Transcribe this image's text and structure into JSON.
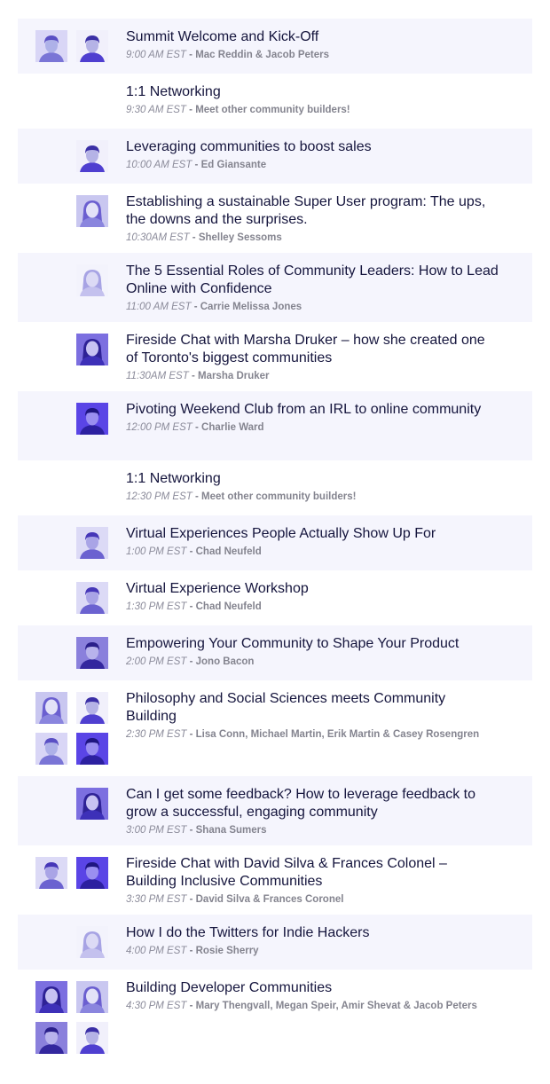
{
  "sessions": [
    {
      "title": "Summit Welcome and Kick-Off",
      "time": "9:00 AM EST",
      "speakers": "Mac Reddin & Jacob Peters",
      "avatars": [
        "a",
        "b"
      ]
    },
    {
      "title": "1:1 Networking",
      "time": "9:30 AM EST",
      "speakers": "Meet other community builders!",
      "avatars": []
    },
    {
      "title": "Leveraging communities to boost sales",
      "time": "10:00 AM EST",
      "speakers": "Ed Giansante",
      "avatars": [
        "b"
      ]
    },
    {
      "title": "Establishing a sustainable Super User program: The ups, the downs and the surprises.",
      "time": "10:30AM EST",
      "speakers": "Shelley Sessoms",
      "avatars": [
        "c"
      ]
    },
    {
      "title": "The 5 Essential Roles of Community Leaders: How to Lead Online with Confidence",
      "time": "11:00 AM EST",
      "speakers": "Carrie Melissa Jones",
      "avatars": [
        "d"
      ]
    },
    {
      "title": "Fireside Chat with Marsha Druker – how she created one of Toronto's biggest communities",
      "time": "11:30AM EST",
      "speakers": "Marsha Druker",
      "avatars": [
        "e"
      ]
    },
    {
      "title": "Pivoting Weekend Club from an IRL to online community",
      "time": "12:00 PM EST",
      "speakers": "Charlie Ward",
      "avatars": [
        "f"
      ]
    },
    {
      "title": "1:1 Networking",
      "time": "12:30 PM EST",
      "speakers": "Meet other community builders!",
      "avatars": []
    },
    {
      "title": "Virtual Experiences People Actually Show Up For",
      "time": "1:00 PM EST",
      "speakers": "Chad Neufeld",
      "avatars": [
        "g"
      ]
    },
    {
      "title": "Virtual Experience Workshop",
      "time": "1:30 PM EST",
      "speakers": "Chad Neufeld",
      "avatars": [
        "g"
      ]
    },
    {
      "title": "Empowering Your Community to Shape Your Product",
      "time": "2:00 PM EST",
      "speakers": "Jono Bacon",
      "avatars": [
        "h"
      ]
    },
    {
      "title": "Philosophy and Social Sciences meets Community Building",
      "time": "2:30 PM EST",
      "speakers": "Lisa Conn, Michael Martin, Erik Martin & Casey Rosengren",
      "avatars": [
        "c",
        "b",
        "a",
        "f"
      ]
    },
    {
      "title": "Can I get some feedback? How to leverage feedback to grow a successful, engaging community",
      "time": "3:00 PM EST",
      "speakers": "Shana Sumers",
      "avatars": [
        "e"
      ]
    },
    {
      "title": "Fireside Chat with David Silva & Frances Colonel – Building Inclusive Communities",
      "time": "3:30 PM  EST",
      "speakers": "David Silva & Frances Coronel",
      "avatars": [
        "g",
        "f"
      ]
    },
    {
      "title": "How I do the Twitters for Indie Hackers",
      "time": "4:00 PM EST",
      "speakers": "Rosie Sherry",
      "avatars": [
        "d"
      ]
    },
    {
      "title": "Building Developer Communities",
      "time": "4:30 PM EST",
      "speakers": "Mary Thengvall, Megan Speir, Amir Shevat & Jacob Peters",
      "avatars": [
        "e",
        "c",
        "h",
        "b"
      ]
    }
  ]
}
